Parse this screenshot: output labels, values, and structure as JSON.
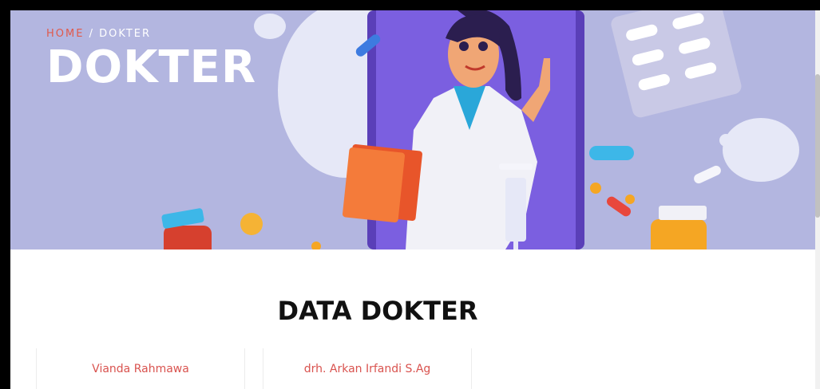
{
  "breadcrumb": {
    "home": "HOME",
    "separator": " / ",
    "current": "DOKTER"
  },
  "hero": {
    "title": "DOKTER"
  },
  "section": {
    "heading_light": "DATA ",
    "heading_bold": "DOKTER"
  },
  "doctors": [
    {
      "name": "Vianda Rahmawa"
    },
    {
      "name": "drh. Arkan Irfandi S.Ag"
    }
  ],
  "colors": {
    "hero_bg": "#b3b6e0",
    "accent": "#e05a4c",
    "doctor_name": "#d9534f",
    "phone": "#7b5fe0"
  },
  "hero_illustration": {
    "subject": "doctor-illustration",
    "items": [
      "pill-icon",
      "capsule-icon",
      "medicine-bottle-icon",
      "syringe-icon",
      "clipboard-icon",
      "blister-pack-icon"
    ]
  }
}
